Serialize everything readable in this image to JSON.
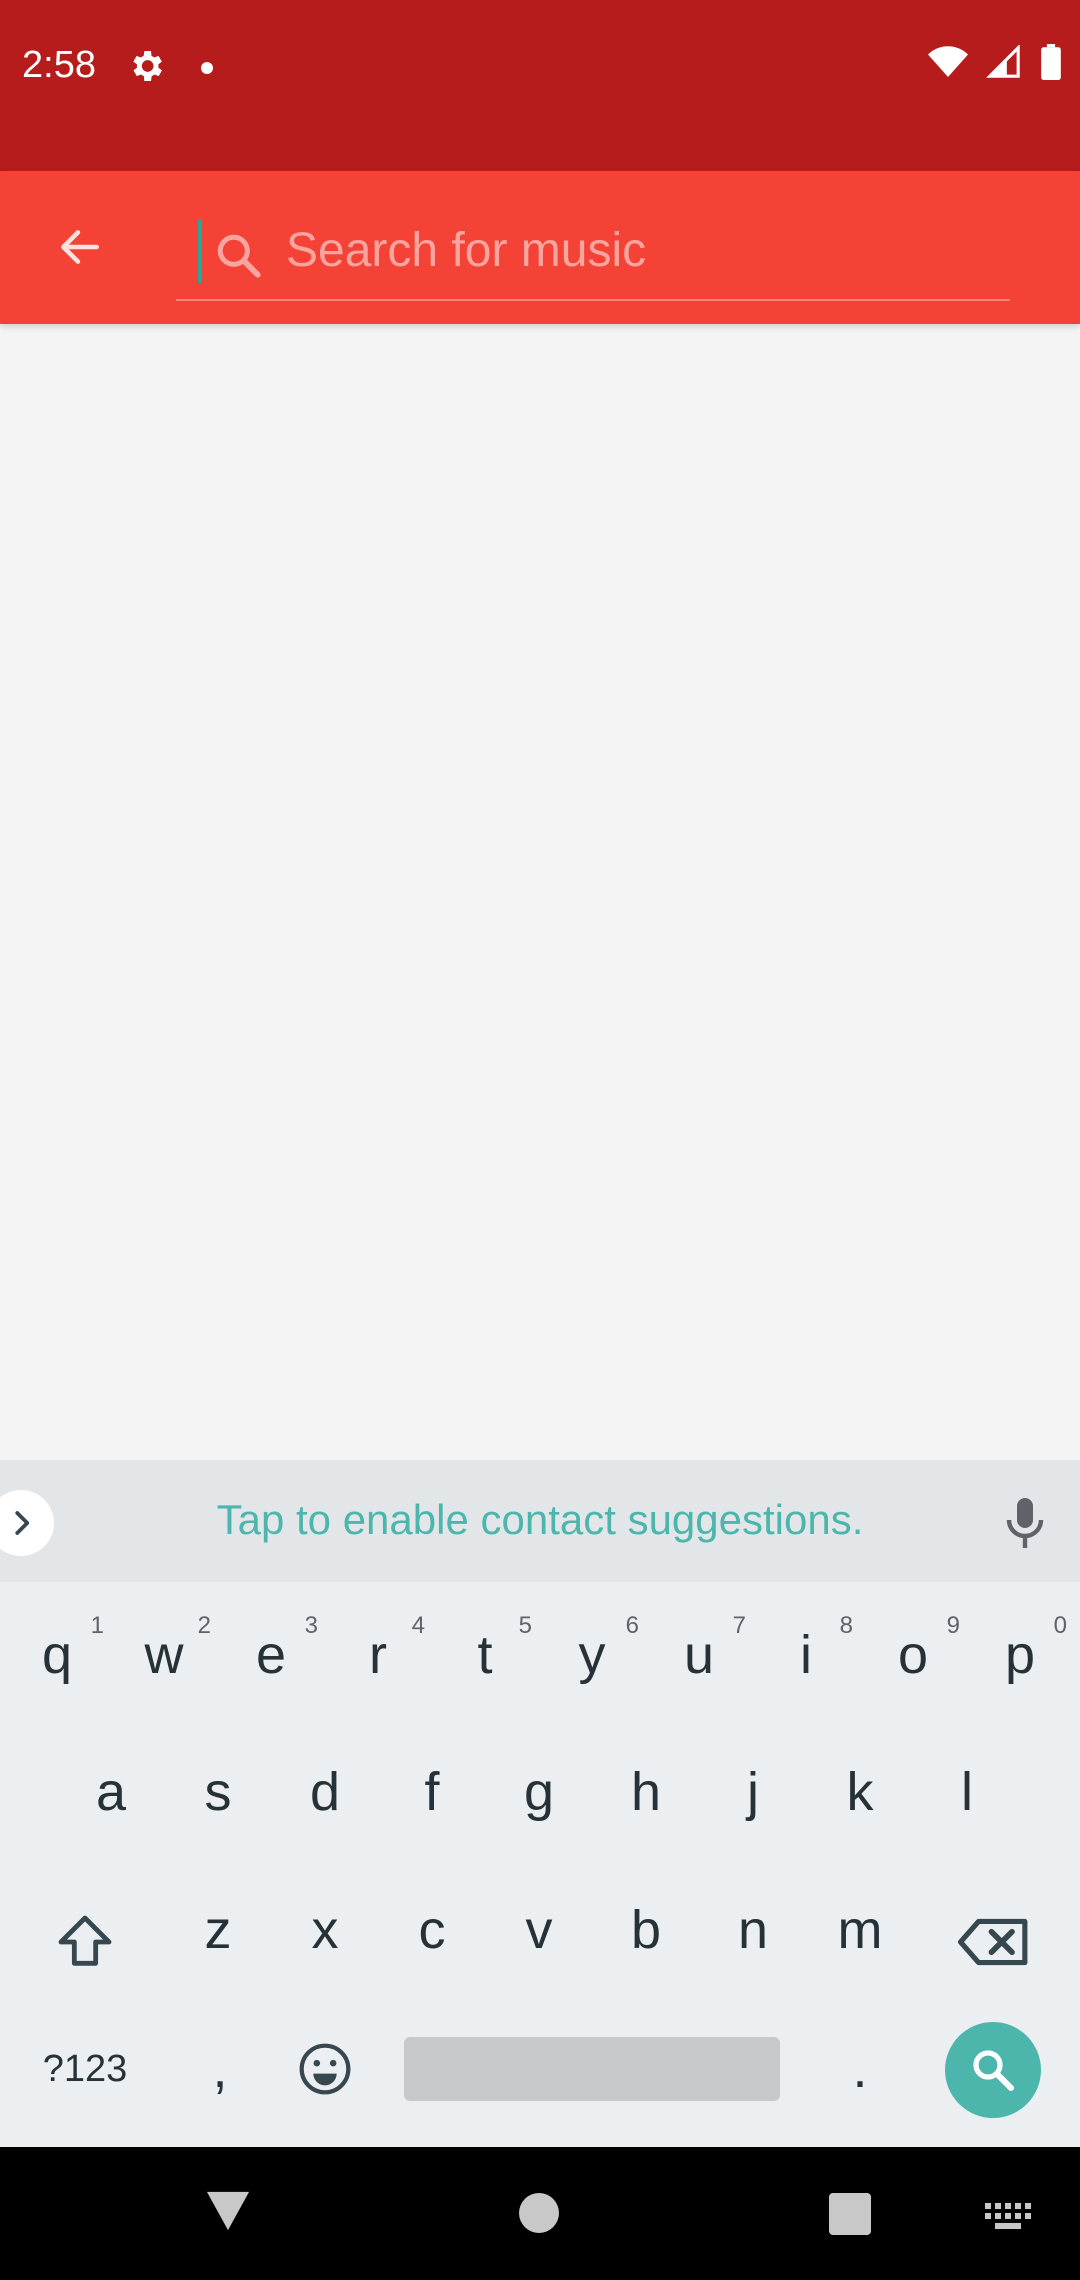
{
  "status_bar": {
    "time": "2:58",
    "icons": [
      "settings-icon",
      "notification-dot",
      "wifi-icon",
      "signal-icon",
      "battery-icon"
    ],
    "background_color": "#b71c1c"
  },
  "app_bar": {
    "background_color": "#f44336",
    "back_icon": "arrow-left-icon",
    "search": {
      "placeholder": "Search for music",
      "value": "",
      "icon": "search-icon"
    }
  },
  "keyboard": {
    "suggestion_text": "Tap to enable contact suggestions.",
    "row1": [
      {
        "key": "q",
        "sup": "1"
      },
      {
        "key": "w",
        "sup": "2"
      },
      {
        "key": "e",
        "sup": "3"
      },
      {
        "key": "r",
        "sup": "4"
      },
      {
        "key": "t",
        "sup": "5"
      },
      {
        "key": "y",
        "sup": "6"
      },
      {
        "key": "u",
        "sup": "7"
      },
      {
        "key": "i",
        "sup": "8"
      },
      {
        "key": "o",
        "sup": "9"
      },
      {
        "key": "p",
        "sup": "0"
      }
    ],
    "row2": [
      "a",
      "s",
      "d",
      "f",
      "g",
      "h",
      "j",
      "k",
      "l"
    ],
    "row3": [
      "z",
      "x",
      "c",
      "v",
      "b",
      "n",
      "m"
    ],
    "symbols_label": "?123",
    "comma": ",",
    "period": ".",
    "action_icon": "search-icon",
    "accent_color": "#4db6ac"
  },
  "nav_bar": {
    "icons": [
      "back-triangle-icon",
      "home-circle-icon",
      "recents-square-icon",
      "keyboard-icon"
    ]
  }
}
